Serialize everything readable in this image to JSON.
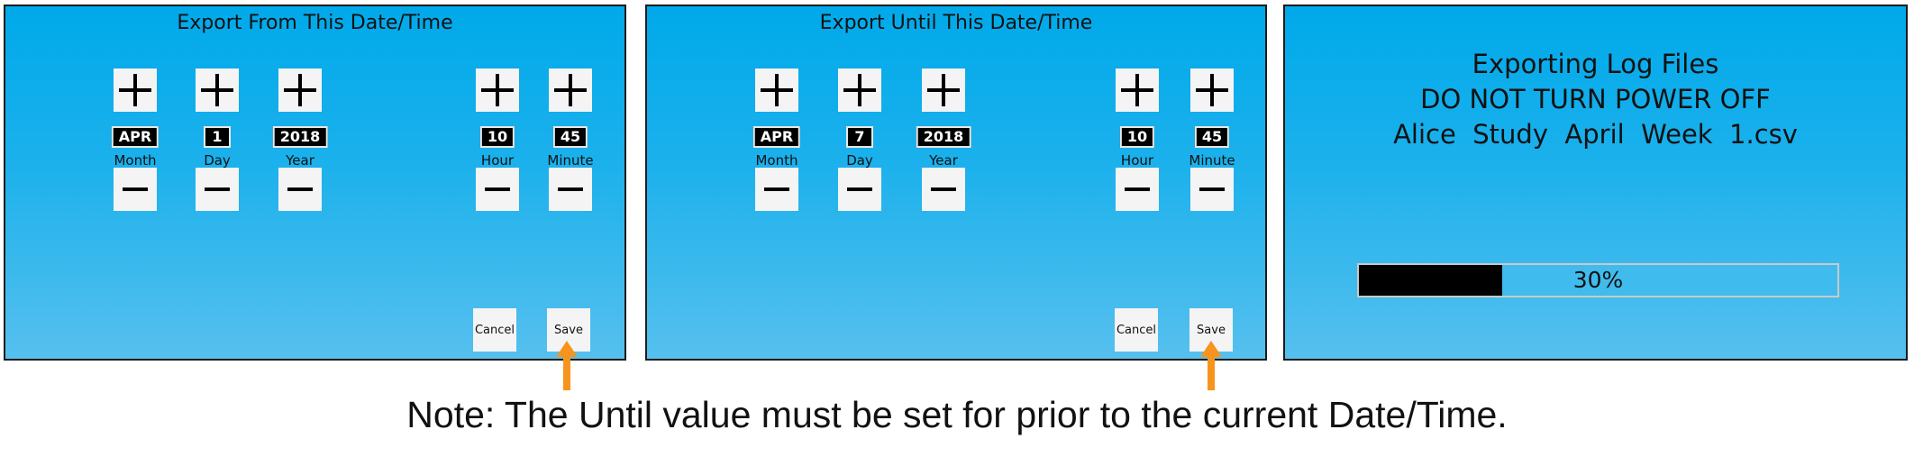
{
  "from_screen": {
    "title": "Export From This Date/Time",
    "month": {
      "label": "Month",
      "value": "APR"
    },
    "day": {
      "label": "Day",
      "value": "1"
    },
    "year": {
      "label": "Year",
      "value": "2018"
    },
    "hour": {
      "label": "Hour",
      "value": "10"
    },
    "minute": {
      "label": "Minute",
      "value": "45"
    },
    "cancel_label": "Cancel",
    "save_label": "Save"
  },
  "until_screen": {
    "title": "Export Until This Date/Time",
    "month": {
      "label": "Month",
      "value": "APR"
    },
    "day": {
      "label": "Day",
      "value": "7"
    },
    "year": {
      "label": "Year",
      "value": "2018"
    },
    "hour": {
      "label": "Hour",
      "value": "10"
    },
    "minute": {
      "label": "Minute",
      "value": "45"
    },
    "cancel_label": "Cancel",
    "save_label": "Save"
  },
  "export_screen": {
    "line1": "Exporting Log Files",
    "line2": "DO NOT TURN POWER OFF",
    "filename": "Alice  Study  April  Week  1.csv",
    "progress_text": "30%",
    "progress_fraction": 0.3
  },
  "note": "Note: The Until value must be set for prior to the current Date/Time.",
  "colors": {
    "screen_gradient_top": "#00a9ea",
    "screen_gradient_bottom": "#56c0ee",
    "arrow": "#f7941d",
    "value_bg": "#000000",
    "button_bg": "#f4f4f4"
  },
  "icons": {
    "increment": "plus-icon",
    "decrement": "minus-icon",
    "pointer": "up-arrow-icon"
  }
}
